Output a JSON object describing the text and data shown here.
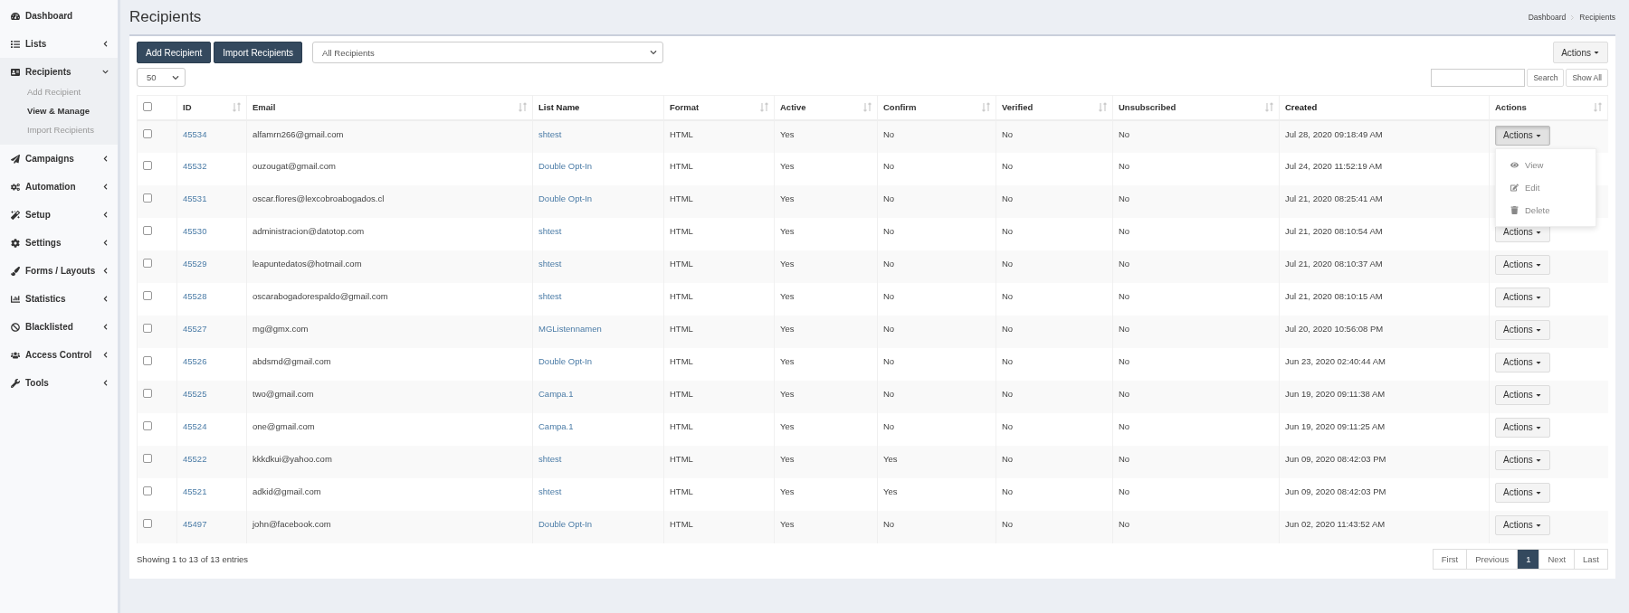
{
  "sidebar": {
    "items": [
      {
        "label": "Dashboard"
      },
      {
        "label": "Lists",
        "expanded": false
      },
      {
        "label": "Recipients",
        "expanded": true,
        "children": [
          {
            "label": "Add Recipient",
            "selected": false
          },
          {
            "label": "View & Manage",
            "selected": true
          },
          {
            "label": "Import Recipients",
            "selected": false
          }
        ]
      },
      {
        "label": "Campaigns",
        "expanded": false
      },
      {
        "label": "Automation",
        "expanded": false
      },
      {
        "label": "Setup",
        "expanded": false
      },
      {
        "label": "Settings",
        "expanded": false
      },
      {
        "label": "Forms / Layouts",
        "expanded": false
      },
      {
        "label": "Statistics",
        "expanded": false
      },
      {
        "label": "Blacklisted",
        "expanded": false
      },
      {
        "label": "Access Control",
        "expanded": false
      },
      {
        "label": "Tools",
        "expanded": false
      }
    ]
  },
  "page": {
    "title": "Recipients",
    "breadcrumb": [
      "Dashboard",
      "Recipients"
    ]
  },
  "toolbar": {
    "buttons": [
      "Add Recipient",
      "Import Recipients"
    ],
    "filter": "All Recipients",
    "actions_button": "Actions",
    "per_page": "50",
    "search": {
      "button": "Search",
      "show_all": "Show All"
    }
  },
  "table": {
    "select_all_checked": false,
    "columns": [
      {
        "label": "ID",
        "sortable": true
      },
      {
        "label": "Email",
        "sortable": true
      },
      {
        "label": "List Name",
        "sortable": false
      },
      {
        "label": "Format",
        "sortable": true
      },
      {
        "label": "Active",
        "sortable": true
      },
      {
        "label": "Confirm",
        "sortable": true
      },
      {
        "label": "Verified",
        "sortable": true
      },
      {
        "label": "Unsubscribed",
        "sortable": true
      },
      {
        "label": "Created",
        "sortable": false
      },
      {
        "label": "Actions",
        "sortable": true
      }
    ],
    "rows": [
      {
        "checked": false,
        "id": "45534",
        "email": "alfamrn266@gmail.com",
        "list_name": "shtest",
        "format": "HTML",
        "active": "Yes",
        "confirm": "No",
        "verified": "No",
        "unsubscribed": "No",
        "created": "Jul 28, 2020 09:18:49 AM",
        "actions": {
          "label": "Actions",
          "open": true
        }
      },
      {
        "checked": false,
        "id": "45532",
        "email": "ouzougat@gmail.com",
        "list_name": "Double Opt-In",
        "format": "HTML",
        "active": "Yes",
        "confirm": "No",
        "verified": "No",
        "unsubscribed": "No",
        "created": "Jul 24, 2020 11:52:19 AM"
      },
      {
        "checked": false,
        "id": "45531",
        "email": "oscar.flores@lexcobroabogados.cl",
        "list_name": "Double Opt-In",
        "format": "HTML",
        "active": "Yes",
        "confirm": "No",
        "verified": "No",
        "unsubscribed": "No",
        "created": "Jul 21, 2020 08:25:41 AM"
      },
      {
        "checked": false,
        "id": "45530",
        "email": "administracion@datotop.com",
        "list_name": "shtest",
        "format": "HTML",
        "active": "Yes",
        "confirm": "No",
        "verified": "No",
        "unsubscribed": "No",
        "created": "Jul 21, 2020 08:10:54 AM",
        "actions": {
          "label": "Actions",
          "open": false
        }
      },
      {
        "checked": false,
        "id": "45529",
        "email": "leapuntedatos@hotmail.com",
        "list_name": "shtest",
        "format": "HTML",
        "active": "Yes",
        "confirm": "No",
        "verified": "No",
        "unsubscribed": "No",
        "created": "Jul 21, 2020 08:10:37 AM",
        "actions": {
          "label": "Actions",
          "open": false
        }
      },
      {
        "checked": false,
        "id": "45528",
        "email": "oscarabogadorespaldo@gmail.com",
        "list_name": "shtest",
        "format": "HTML",
        "active": "Yes",
        "confirm": "No",
        "verified": "No",
        "unsubscribed": "No",
        "created": "Jul 21, 2020 08:10:15 AM",
        "actions": {
          "label": "Actions",
          "open": false
        }
      },
      {
        "checked": false,
        "id": "45527",
        "email": "mg@gmx.com",
        "list_name": "MGListennamen",
        "format": "HTML",
        "active": "Yes",
        "confirm": "No",
        "verified": "No",
        "unsubscribed": "No",
        "created": "Jul 20, 2020 10:56:08 PM",
        "actions": {
          "label": "Actions",
          "open": false
        }
      },
      {
        "checked": false,
        "id": "45526",
        "email": "abdsmd@gmail.com",
        "list_name": "Double Opt-In",
        "format": "HTML",
        "active": "Yes",
        "confirm": "No",
        "verified": "No",
        "unsubscribed": "No",
        "created": "Jun 23, 2020 02:40:44 AM",
        "actions": {
          "label": "Actions",
          "open": false
        }
      },
      {
        "checked": false,
        "id": "45525",
        "email": "two@gmail.com",
        "list_name": "Campa.1",
        "format": "HTML",
        "active": "Yes",
        "confirm": "No",
        "verified": "No",
        "unsubscribed": "No",
        "created": "Jun 19, 2020 09:11:38 AM",
        "actions": {
          "label": "Actions",
          "open": false
        }
      },
      {
        "checked": false,
        "id": "45524",
        "email": "one@gmail.com",
        "list_name": "Campa.1",
        "format": "HTML",
        "active": "Yes",
        "confirm": "No",
        "verified": "No",
        "unsubscribed": "No",
        "created": "Jun 19, 2020 09:11:25 AM",
        "actions": {
          "label": "Actions",
          "open": false
        }
      },
      {
        "checked": false,
        "id": "45522",
        "email": "kkkdkui@yahoo.com",
        "list_name": "shtest",
        "format": "HTML",
        "active": "Yes",
        "confirm": "Yes",
        "verified": "No",
        "unsubscribed": "No",
        "created": "Jun 09, 2020 08:42:03 PM",
        "actions": {
          "label": "Actions",
          "open": false
        }
      },
      {
        "checked": false,
        "id": "45521",
        "email": "adkid@gmail.com",
        "list_name": "shtest",
        "format": "HTML",
        "active": "Yes",
        "confirm": "Yes",
        "verified": "No",
        "unsubscribed": "No",
        "created": "Jun 09, 2020 08:42:03 PM",
        "actions": {
          "label": "Actions",
          "open": false
        }
      },
      {
        "checked": false,
        "id": "45497",
        "email": "john@facebook.com",
        "list_name": "Double Opt-In",
        "format": "HTML",
        "active": "Yes",
        "confirm": "No",
        "verified": "No",
        "unsubscribed": "No",
        "created": "Jun 02, 2020 11:43:52 AM",
        "actions": {
          "label": "Actions",
          "open": false
        }
      }
    ],
    "row_menu": [
      {
        "kind": "view",
        "label": "View"
      },
      {
        "kind": "edit",
        "label": "Edit"
      },
      {
        "kind": "delete",
        "label": "Delete"
      }
    ]
  },
  "footer": {
    "info": "Showing 1 to 13 of 13 entries",
    "pagination": [
      {
        "label": "First",
        "selected": false
      },
      {
        "label": "Previous",
        "selected": false
      },
      {
        "label": "1",
        "selected": true
      },
      {
        "label": "Next",
        "selected": false
      },
      {
        "label": "Last",
        "selected": false
      }
    ]
  }
}
